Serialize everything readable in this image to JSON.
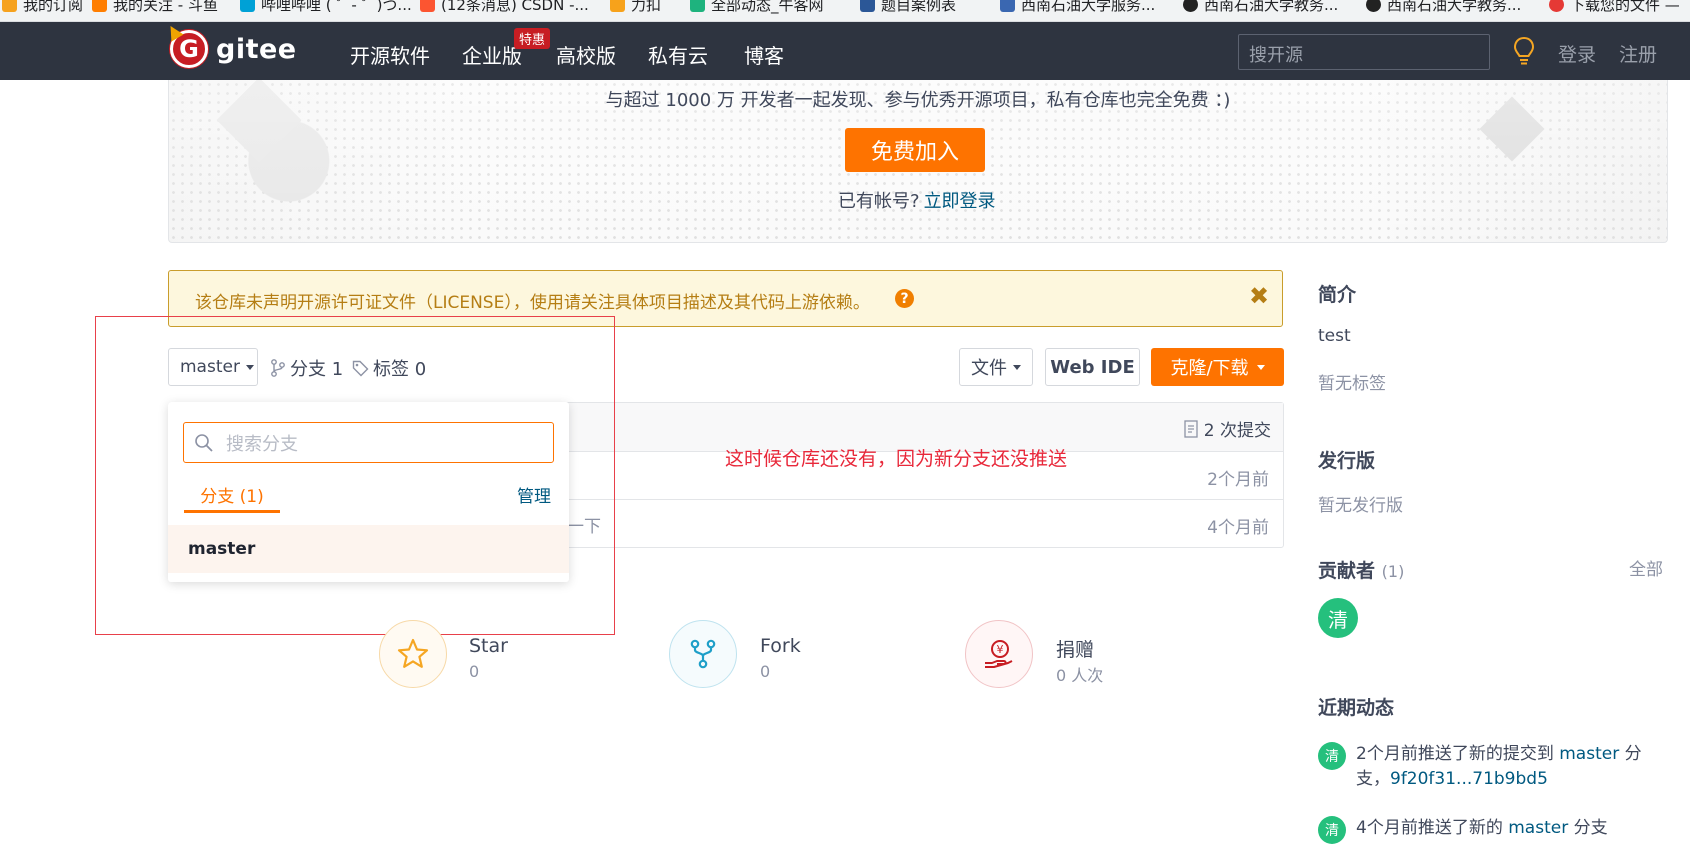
{
  "bookmarks": [
    {
      "label": "我的订阅",
      "color": "#f6a21e"
    },
    {
      "label": "我的关注 - 斗鱼",
      "color": "#ff7e00"
    },
    {
      "label": "哔哩哔哩 ( ゜- ゜)つ...",
      "color": "#00a1d6"
    },
    {
      "label": "(12条消息) CSDN -...",
      "color": "#fc5531"
    },
    {
      "label": "力扣",
      "color": "#f7a21b"
    },
    {
      "label": "全部动态_牛客网",
      "color": "#1eb37e"
    },
    {
      "label": "题目案例表",
      "color": "#2b5797"
    },
    {
      "label": "西南石油大学服务...",
      "color": "#3a67b1"
    },
    {
      "label": "西南石油大学教务...",
      "color": "#222222"
    },
    {
      "label": "西南石油大学教务...",
      "color": "#222222"
    },
    {
      "label": "下载您的文件 —",
      "color": "#e53935"
    }
  ],
  "nav": {
    "logo_text": "gitee",
    "links": [
      "开源软件",
      "企业版",
      "高校版",
      "私有云",
      "博客"
    ],
    "badge": "特惠",
    "search_placeholder": "搜开源",
    "login": "登录",
    "register": "注册"
  },
  "banner": {
    "subtitle": "与超过 1000 万 开发者一起发现、参与优秀开源项目，私有仓库也完全免费 ：)",
    "join_button": "免费加入",
    "have_account": "已有帐号?",
    "login_link": "立即登录"
  },
  "license_warning": {
    "text": "该仓库未声明开源许可证文件（LICENSE），使用请关注具体项目描述及其代码上游依赖。",
    "help": "?",
    "close": "✖"
  },
  "toolbar": {
    "branch": "master",
    "branches": "分支 1",
    "tags": "标签 0",
    "file_button": "文件",
    "webide_button": "Web IDE",
    "clone_button": "克隆/下载"
  },
  "files": {
    "commits": "2 次提交",
    "rows": [
      {
        "partial_text": "",
        "age": "2个月前"
      },
      {
        "partial_text": "一下",
        "age": "4个月前"
      }
    ]
  },
  "branch_dropdown": {
    "search_placeholder": "搜索分支",
    "tab_label": "分支 (1)",
    "manage": "管理",
    "items": [
      "master"
    ]
  },
  "annotation": "这时候仓库还没有，因为新分支还没推送",
  "stats": [
    {
      "label": "Star",
      "value": "0",
      "icon": "star-icon",
      "color": "#f5a623"
    },
    {
      "label": "Fork",
      "value": "0",
      "icon": "fork-icon",
      "color": "#1e9fc8"
    },
    {
      "label": "捐赠",
      "value": "0 人次",
      "icon": "donate-icon",
      "color": "#c71d23"
    }
  ],
  "sidebar": {
    "intro_title": "简介",
    "intro_text": "test",
    "no_tags": "暂无标签",
    "release_title": "发行版",
    "no_release": "暂无发行版",
    "contrib_title": "贡献者",
    "contrib_count": "(1)",
    "contrib_all": "全部",
    "contrib_avatar": "清",
    "activity_title": "近期动态",
    "activities": [
      {
        "avatar": "清",
        "before": "2个月前推送了新的提交到 ",
        "branch": "master",
        "after": " 分支，",
        "hash": "9f20f31...71b9bd5"
      },
      {
        "avatar": "清",
        "before": "4个月前推送了新的 ",
        "branch": "master",
        "after": " 分支",
        "hash": ""
      }
    ]
  }
}
